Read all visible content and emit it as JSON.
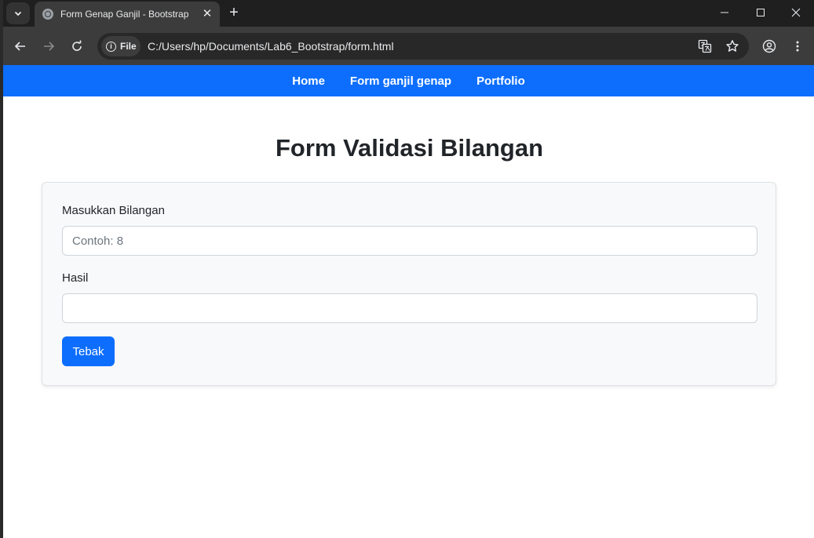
{
  "browser": {
    "tab_title": "Form Genap Ganjil - Bootstrap",
    "security_chip": "File",
    "url": "C:/Users/hp/Documents/Lab6_Bootstrap/form.html"
  },
  "navbar": {
    "items": [
      "Home",
      "Form ganjil genap",
      "Portfolio"
    ],
    "color": "#0d6efd"
  },
  "page": {
    "heading": "Form Validasi Bilangan"
  },
  "form": {
    "number_label": "Masukkan Bilangan",
    "number_placeholder": "Contoh: 8",
    "number_value": "",
    "result_label": "Hasil",
    "result_value": "",
    "submit_label": "Tebak"
  }
}
